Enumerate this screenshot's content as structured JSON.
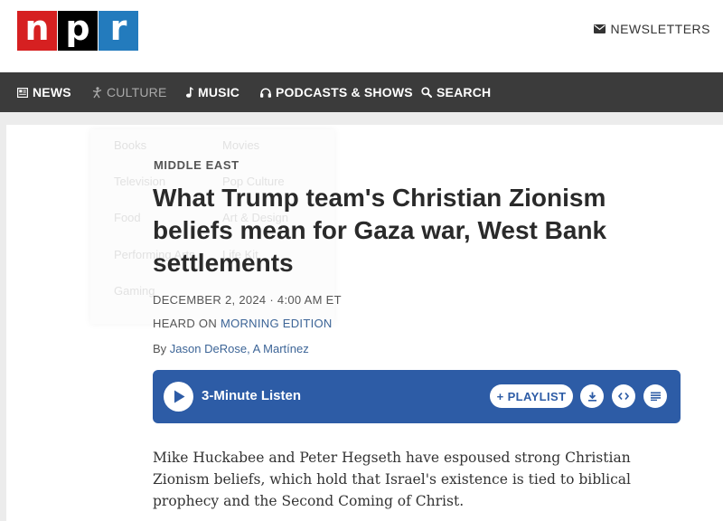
{
  "header": {
    "logo_letters": [
      "n",
      "p",
      "r"
    ],
    "newsletters_label": "NEWSLETTERS",
    "newsletters_icon": "envelope-icon"
  },
  "nav": {
    "items": [
      {
        "label": "NEWS",
        "icon": "newspaper-icon"
      },
      {
        "label": "CULTURE",
        "icon": "culture-icon"
      },
      {
        "label": "MUSIC",
        "icon": "music-note-icon"
      },
      {
        "label": "PODCASTS & SHOWS",
        "icon": "headphones-icon"
      },
      {
        "label": "SEARCH",
        "icon": "search-icon"
      }
    ]
  },
  "culture_menu": {
    "items": [
      "Books",
      "Movies",
      "Television",
      "Pop Culture",
      "Food",
      "Art & Design",
      "Performing Arts",
      "Life Kit",
      "Gaming"
    ]
  },
  "article": {
    "slug": "MIDDLE EAST",
    "headline": "What Trump team's Christian Zionism beliefs mean for Gaza war, West Bank settlements",
    "dateline": "DECEMBER 2, 2024 · 4:00 AM ET",
    "heard_on_prefix": "HEARD ON ",
    "heard_on_show": "MORNING EDITION",
    "byline_prefix": "By ",
    "author_1": "Jason DeRose",
    "byline_separator": ", ",
    "author_2": "A Martínez",
    "body": "Mike Huckabee and Peter Hegseth have espoused strong Christian Zionism beliefs, which hold that Israel's existence is tied to biblical prophecy and the Second Coming of Christ."
  },
  "player": {
    "listen_label": "3-Minute Listen",
    "playlist_label": "+ PLAYLIST",
    "icons": [
      "play-icon",
      "download-icon",
      "embed-icon",
      "transcript-icon"
    ],
    "accent_color": "#2d5ca6"
  }
}
